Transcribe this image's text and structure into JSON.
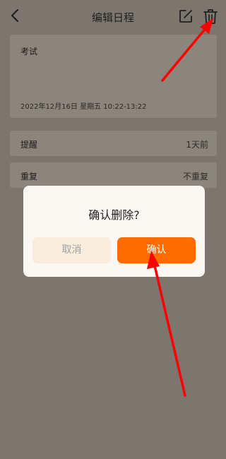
{
  "header": {
    "title": "编辑日程",
    "back_icon": "chevron-left-icon",
    "edit_icon": "edit-icon",
    "delete_icon": "trash-icon"
  },
  "event": {
    "title": "考试",
    "time": "2022年12月16日 星期五 10:22-13:22"
  },
  "settings": [
    {
      "label": "提醒",
      "value": "1天前"
    },
    {
      "label": "重复",
      "value": "不重复"
    }
  ],
  "dialog": {
    "message": "确认删除?",
    "cancel_label": "取消",
    "confirm_label": "确认"
  },
  "colors": {
    "accent": "#ff6c00",
    "annotation_arrow": "#ff0000",
    "overlay": "#7c766e"
  }
}
